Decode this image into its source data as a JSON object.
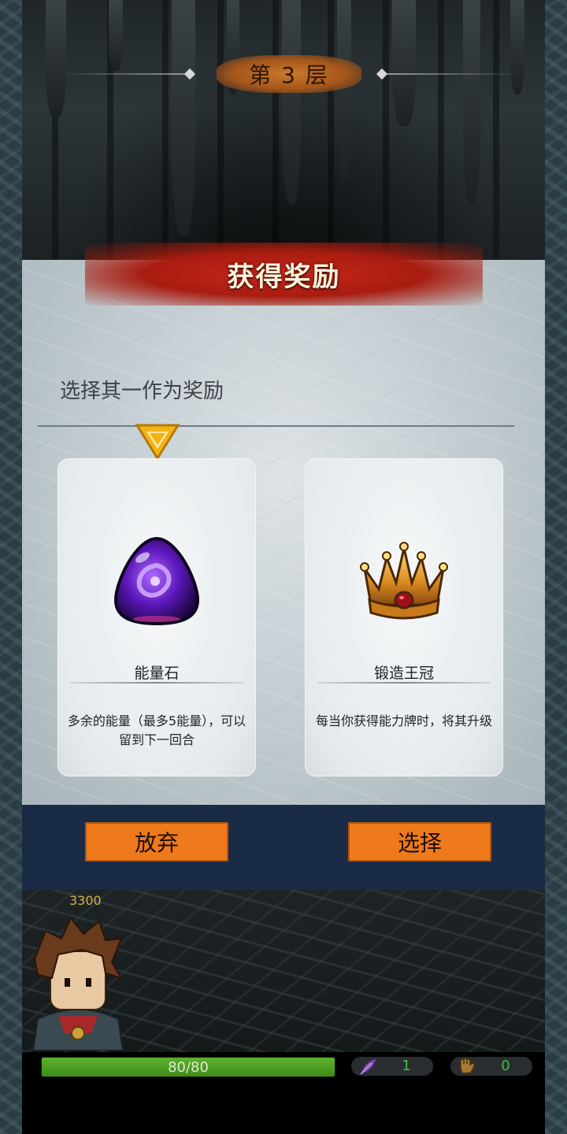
{
  "floor": {
    "label": "第 3 层"
  },
  "banner": {
    "title": "获得奖励"
  },
  "prompt": {
    "text": "选择其一作为奖励"
  },
  "cards": [
    {
      "name": "能量石",
      "description": "多余的能量（最多5能量），可以留到下一回合",
      "icon": "purple-energy-stone-icon"
    },
    {
      "name": "锻造王冠",
      "description": "每当你获得能力牌时，将其升级",
      "icon": "gold-crown-icon"
    }
  ],
  "actions": {
    "abandon_label": "放弃",
    "choose_label": "选择"
  },
  "player": {
    "gold": "3300",
    "hp_text": "80/80",
    "hp_current": 80,
    "hp_max": 80,
    "feather_count": "1",
    "fist_count": "0"
  },
  "colors": {
    "button": "#ee7a1c",
    "banner": "#c8291a",
    "hp_bar": "#4fa025",
    "stat_value": "#3fbf3a",
    "action_bar": "#1a2b45"
  }
}
